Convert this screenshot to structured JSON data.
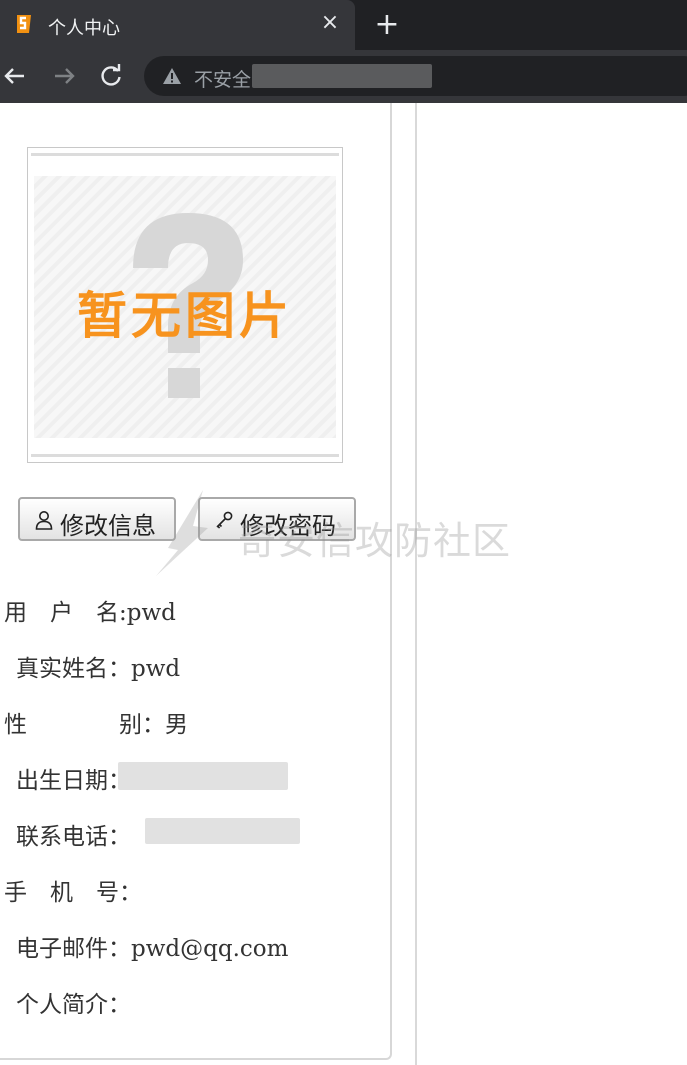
{
  "browser": {
    "tab_title": "个人中心",
    "close_glyph": "×",
    "new_tab_glyph": "+",
    "security_text": "不安全",
    "icons": [
      "tab-favicon",
      "close-icon",
      "plus-icon",
      "back-arrow-icon",
      "forward-arrow-icon",
      "reload-icon",
      "warning-icon"
    ]
  },
  "profile": {
    "avatar_text": "暂无图片",
    "edit_info_label": "修改信息",
    "change_password_label": "修改密码",
    "watermark": "奇安信攻防社区",
    "fields": [
      {
        "label": "用　户　名:",
        "value": "pwd"
      },
      {
        "label": "真实姓名：",
        "value": "pwd"
      },
      {
        "label": "性　　　　别：",
        "value": "男"
      },
      {
        "label": "出生日期：",
        "value": ""
      },
      {
        "label": "联系电话：",
        "value": ""
      },
      {
        "label": "手　机　号：",
        "value": ""
      },
      {
        "label": "电子邮件：",
        "value": "pwd@qq.com"
      },
      {
        "label": "个人简介：",
        "value": ""
      }
    ]
  },
  "colors": {
    "tab_bg": "#35363a",
    "chrome_bg": "#202124",
    "avatar_text": "#f7931e"
  }
}
